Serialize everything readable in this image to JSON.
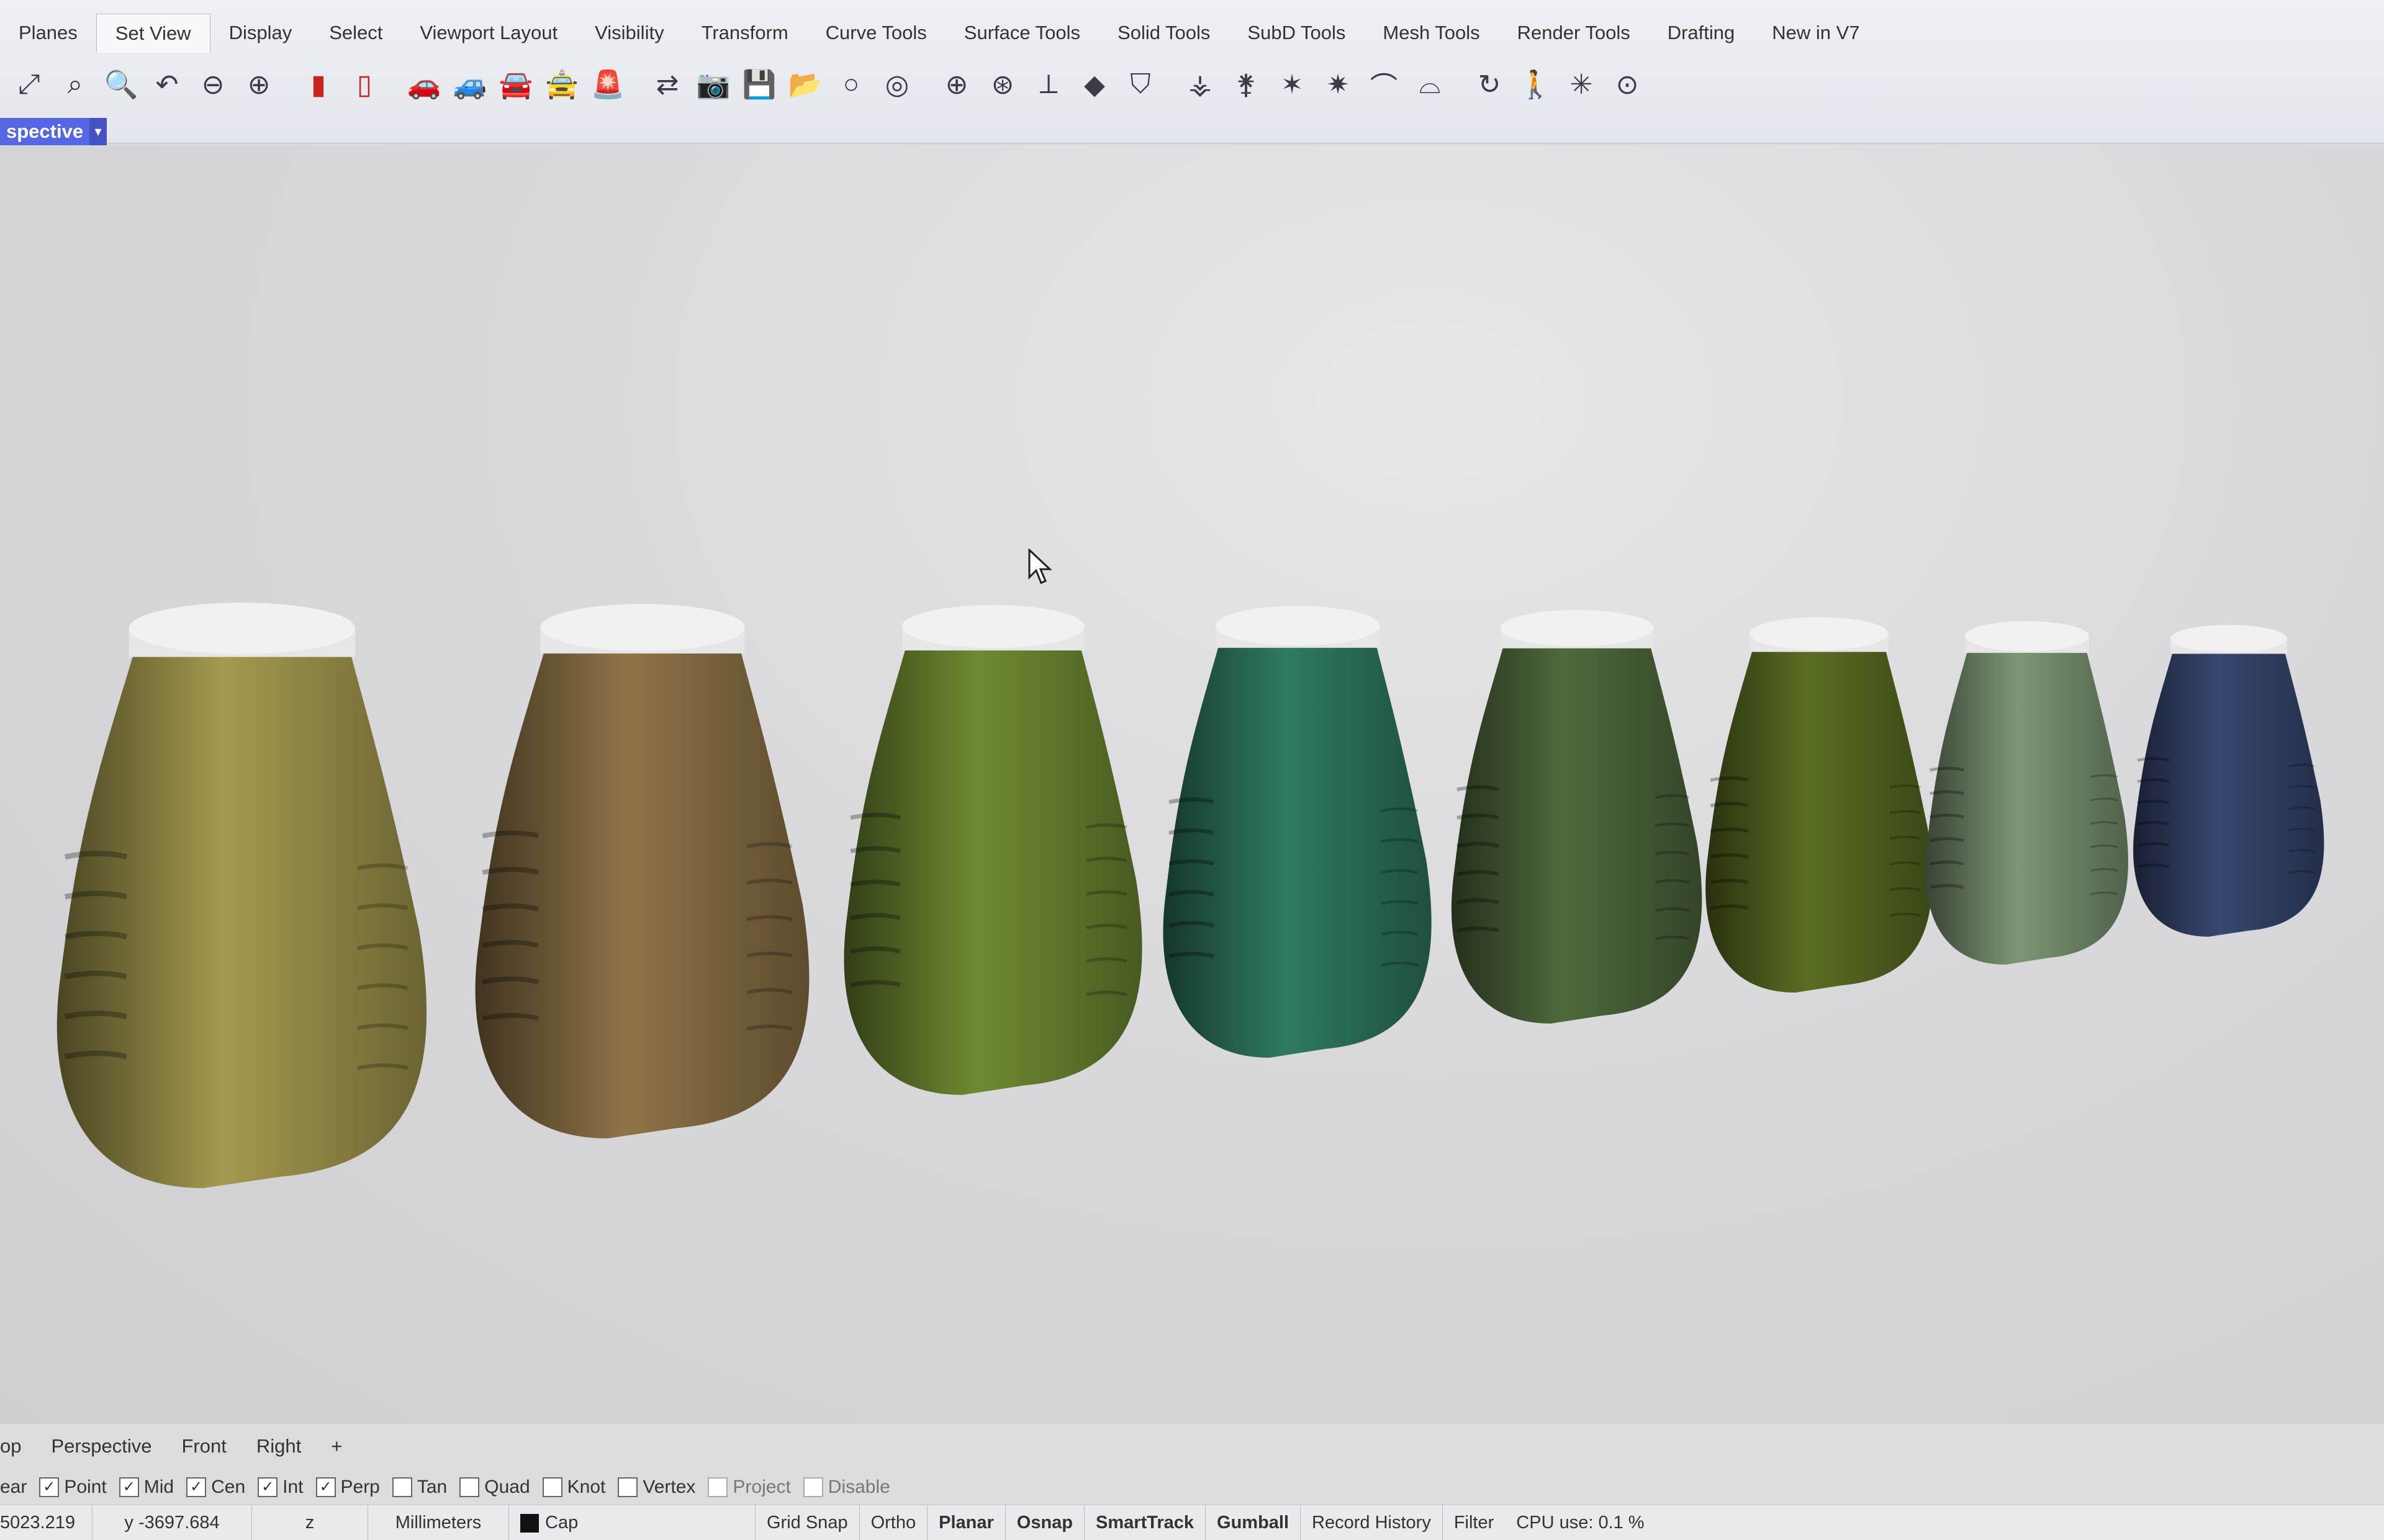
{
  "menu_tabs": [
    "Planes",
    "Set View",
    "Display",
    "Select",
    "Viewport Layout",
    "Visibility",
    "Transform",
    "Curve Tools",
    "Surface Tools",
    "Solid Tools",
    "SubD Tools",
    "Mesh Tools",
    "Render Tools",
    "Drafting",
    "New in V7"
  ],
  "active_tab": "Set View",
  "toolbar_icons": [
    "zoom-extents-icon",
    "zoom-window-icon",
    "zoom-icon",
    "undo-view-icon",
    "zoom-out-icon",
    "zoom-all-icon",
    "named-view-icon",
    "named-view-2-icon",
    "car-icon",
    "car-2-icon",
    "car-3-icon",
    "car-4-icon",
    "car-5-icon",
    "camera-move-icon",
    "camera-icon",
    "save-view-icon",
    "open-view-icon",
    "magnify-icon",
    "magnify-2-icon",
    "target-icon",
    "target-2-icon",
    "axis-icon",
    "cube-icon",
    "shield-icon",
    "tripod-icon",
    "tripod-2-icon",
    "star-icon",
    "star-2-icon",
    "lamp-icon",
    "lamp-2-icon",
    "rotate-icon",
    "walk-icon",
    "sparkle-icon",
    "crosshair-icon"
  ],
  "viewport": {
    "name": "spective"
  },
  "viewport_tabs": [
    "op",
    "Perspective",
    "Front",
    "Right",
    "+"
  ],
  "osnap": [
    {
      "label": "ear",
      "checked": null
    },
    {
      "label": "Point",
      "checked": true
    },
    {
      "label": "Mid",
      "checked": true
    },
    {
      "label": "Cen",
      "checked": true
    },
    {
      "label": "Int",
      "checked": true
    },
    {
      "label": "Perp",
      "checked": true
    },
    {
      "label": "Tan",
      "checked": false
    },
    {
      "label": "Quad",
      "checked": false
    },
    {
      "label": "Knot",
      "checked": false
    },
    {
      "label": "Vertex",
      "checked": false
    },
    {
      "label": "Project",
      "checked": false,
      "disabled": true
    },
    {
      "label": "Disable",
      "checked": false,
      "disabled": true
    }
  ],
  "status": {
    "x": "5023.219",
    "y": "y -3697.684",
    "z": "z",
    "units": "Millimeters",
    "layer": "Cap",
    "toggles": [
      {
        "label": "Grid Snap",
        "bold": false
      },
      {
        "label": "Ortho",
        "bold": false
      },
      {
        "label": "Planar",
        "bold": true
      },
      {
        "label": "Osnap",
        "bold": true
      },
      {
        "label": "SmartTrack",
        "bold": true
      },
      {
        "label": "Gumball",
        "bold": true
      },
      {
        "label": "Record History",
        "bold": false
      },
      {
        "label": "Filter",
        "bold": false
      }
    ],
    "cpu": "CPU use: 0.1 %"
  },
  "bottle_colors": [
    "#a59a4e",
    "#8f7447",
    "#6f8b32",
    "#2f7a63",
    "#4f6a3c",
    "#5a6e22",
    "#7d9775",
    "#37476f"
  ],
  "cap_color": "#f1f1f1"
}
